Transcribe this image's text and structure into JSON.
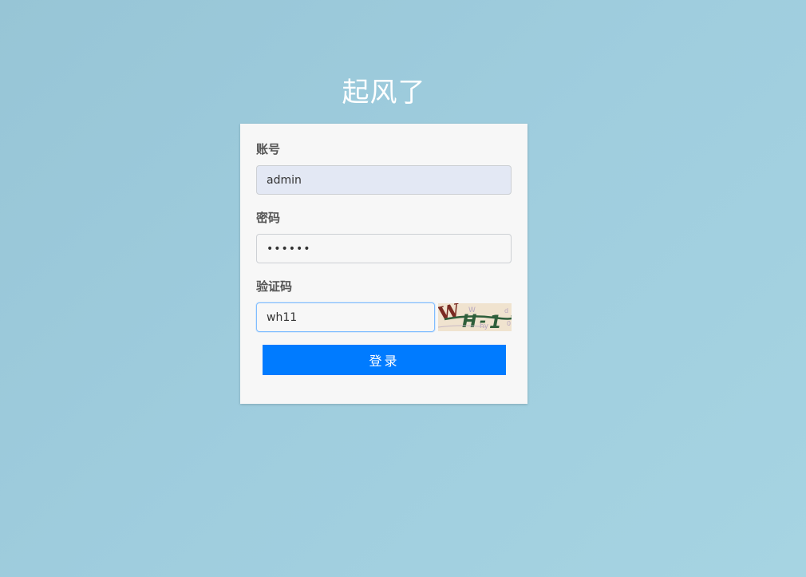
{
  "site_title": "起风了",
  "login_form": {
    "username_label": "账号",
    "username_value": "admin",
    "password_label": "密码",
    "password_value": "123456",
    "captcha_label": "验证码",
    "captcha_value": "wh11",
    "captcha_image_text": "WH1",
    "login_button_label": "登录"
  },
  "colors": {
    "background": "#9fcdde",
    "card": "#f7f7f7",
    "button": "#007bff",
    "autofill": "#e3e8f4"
  }
}
